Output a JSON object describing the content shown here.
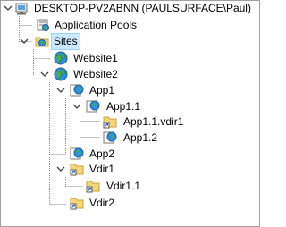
{
  "tree": {
    "server": "DESKTOP-PV2ABNN (PAULSURFACE\\Paul)",
    "app_pools": "Application Pools",
    "sites": "Sites",
    "website1": "Website1",
    "website2": "Website2",
    "app1": "App1",
    "app1_1": "App1.1",
    "app1_1_vdir1": "App1.1.vdir1",
    "app1_2": "App1.2",
    "app2": "App2",
    "vdir1": "Vdir1",
    "vdir1_1": "Vdir1.1",
    "vdir2": "Vdir2"
  },
  "colors": {
    "selection_bg": "#cce8ff",
    "selection_border": "#99d1ff",
    "folder": "#f5d57a",
    "globe": "#2f8fd8",
    "land": "#4caf50"
  }
}
